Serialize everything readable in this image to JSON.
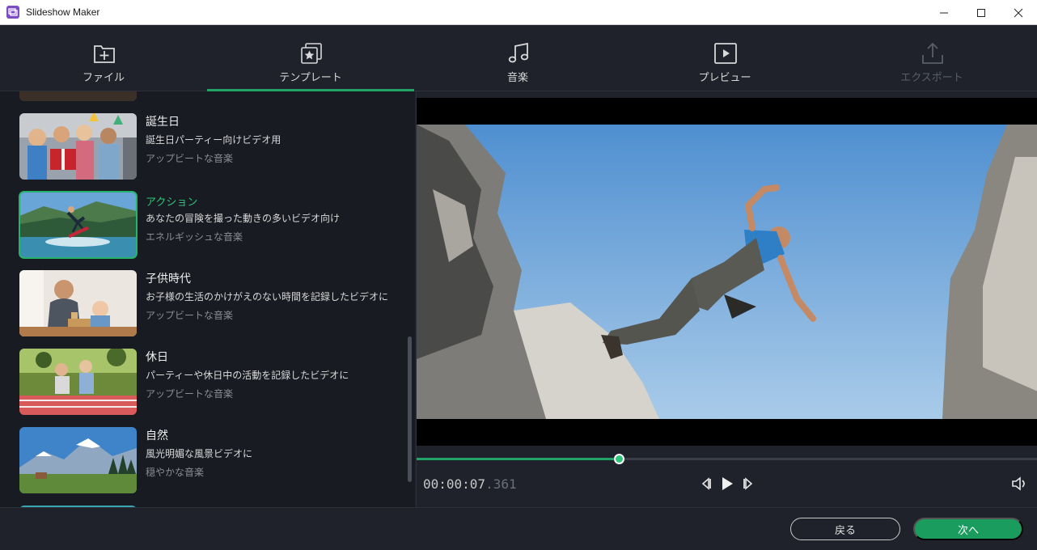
{
  "window": {
    "title": "Slideshow Maker"
  },
  "nav": [
    {
      "label": "ファイル",
      "icon": "add-folder-icon"
    },
    {
      "label": "テンプレート",
      "icon": "template-star-icon"
    },
    {
      "label": "音楽",
      "icon": "music-note-icon"
    },
    {
      "label": "プレビュー",
      "icon": "play-preview-icon"
    },
    {
      "label": "エクスポート",
      "icon": "export-upload-icon"
    }
  ],
  "templates": [
    {
      "title": "誕生日",
      "desc": "誕生日パーティー向けビデオ用",
      "music": "アップビートな音楽"
    },
    {
      "title": "アクション",
      "desc": "あなたの冒険を撮った動きの多いビデオ向け",
      "music": "エネルギッシュな音楽"
    },
    {
      "title": "子供時代",
      "desc": "お子様の生活のかけがえのない時間を記録したビデオに",
      "music": "アップビートな音楽"
    },
    {
      "title": "休日",
      "desc": "パーティーや休日中の活動を記録したビデオに",
      "music": "アップビートな音楽"
    },
    {
      "title": "自然",
      "desc": "風光明媚な風景ビデオに",
      "music": "穏やかな音楽"
    }
  ],
  "player": {
    "time_main": "00:00:07",
    "time_ms": ".361",
    "progress": 0.326
  },
  "buttons": {
    "back": "戻る",
    "next": "次へ"
  },
  "colors": {
    "accent": "#21a365",
    "background": "#1f222b",
    "list_bg": "#191b22"
  }
}
